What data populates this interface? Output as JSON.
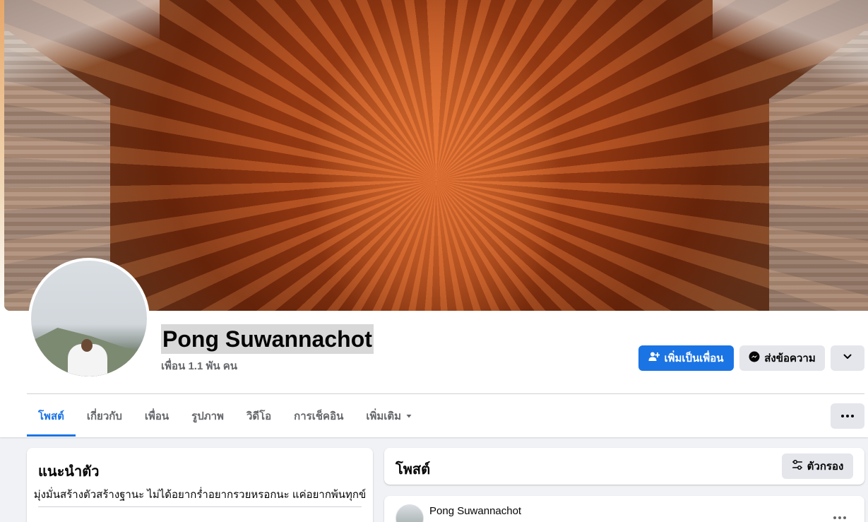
{
  "profile": {
    "name": "Pong Suwannachot",
    "friends_count": "เพื่อน 1.1 พัน คน"
  },
  "actions": {
    "add_friend": "เพิ่มเป็นเพื่อน",
    "message": "ส่งข้อความ"
  },
  "tabs": [
    {
      "label": "โพสต์",
      "active": true
    },
    {
      "label": "เกี่ยวกับ"
    },
    {
      "label": "เพื่อน"
    },
    {
      "label": "รูปภาพ"
    },
    {
      "label": "วิดีโอ"
    },
    {
      "label": "การเช็คอิน"
    },
    {
      "label": "เพิ่มเติม"
    }
  ],
  "intro": {
    "title": "แนะนำตัว",
    "bio": "มุ่งมั่นสร้างตัวสร้างฐานะ ไม่ได้อยากร่ำอยากรวยหรอกนะ แค่อยากพ้นทุกข์"
  },
  "posts": {
    "title": "โพสต์",
    "filter_label": "ตัวกรอง",
    "first_post_author": "Pong Suwannachot"
  },
  "colors": {
    "accent": "#1b74e4",
    "secondary_button": "#e4e6eb",
    "page_background": "#f0f2f5"
  },
  "icons": {
    "add_friend": "add-person-icon",
    "message": "messenger-icon",
    "more": "chevron-down-icon",
    "filter": "sliders-icon",
    "menu": "more-dots-icon"
  }
}
